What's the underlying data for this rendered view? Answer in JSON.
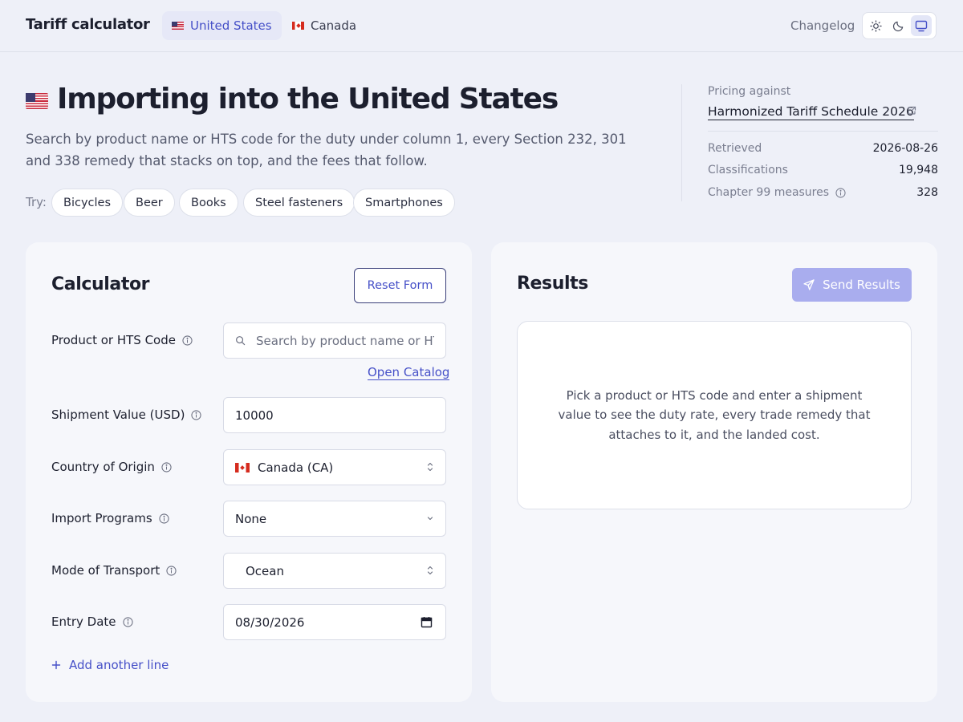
{
  "header": {
    "brand": "Tariff calculator",
    "tabs": [
      {
        "label": "United States",
        "flag": "us-flag-icon",
        "active": true
      },
      {
        "label": "Canada",
        "flag": "canada-flag-icon",
        "active": false
      }
    ],
    "changelog": "Changelog",
    "theme_options": [
      "sun-icon",
      "moon-icon",
      "monitor-icon"
    ],
    "theme_active": "monitor-icon"
  },
  "hero": {
    "title": "Importing into the United States",
    "description": "Search by product name or HTS code for the duty under column 1, every Section 232, 301 and 338 remedy that stacks on top, and the fees that follow.",
    "try_label": "Try:",
    "chips": [
      "Bicycles",
      "Beer",
      "Books",
      "Steel fasteners",
      "Smartphones"
    ]
  },
  "info": {
    "pricing_label": "Pricing against",
    "schedule": "Harmonized Tariff Schedule 2026",
    "rows": [
      {
        "label": "Retrieved",
        "value": "2026-08-26"
      },
      {
        "label": "Classifications",
        "value": "19,948"
      },
      {
        "label": "Chapter 99 measures",
        "value": "328"
      }
    ]
  },
  "calculator": {
    "title": "Calculator",
    "reset_label": "Reset Form",
    "product_label": "Product or HTS Code",
    "product_placeholder": "Search by product name or HTS code",
    "catalog_link": "Open Catalog",
    "value_label": "Shipment Value (USD)",
    "value": "10000",
    "origin_label": "Country of Origin",
    "origin_value": "Canada (CA)",
    "programs_label": "Import Programs",
    "programs_value": "None",
    "transport_label": "Mode of Transport",
    "transport_value": "Ocean",
    "date_label": "Entry Date",
    "date_value": "08/30/2026",
    "add_line": "Add another line"
  },
  "results": {
    "title": "Results",
    "send_label": "Send Results",
    "empty_message": "Pick a product or HTS code and enter a shipment value to see the duty rate, every trade remedy that attaches to it, and the landed cost."
  },
  "colors": {
    "accent": "#4650c8",
    "send_disabled": "#a9adee",
    "background": "#eef0f8"
  }
}
